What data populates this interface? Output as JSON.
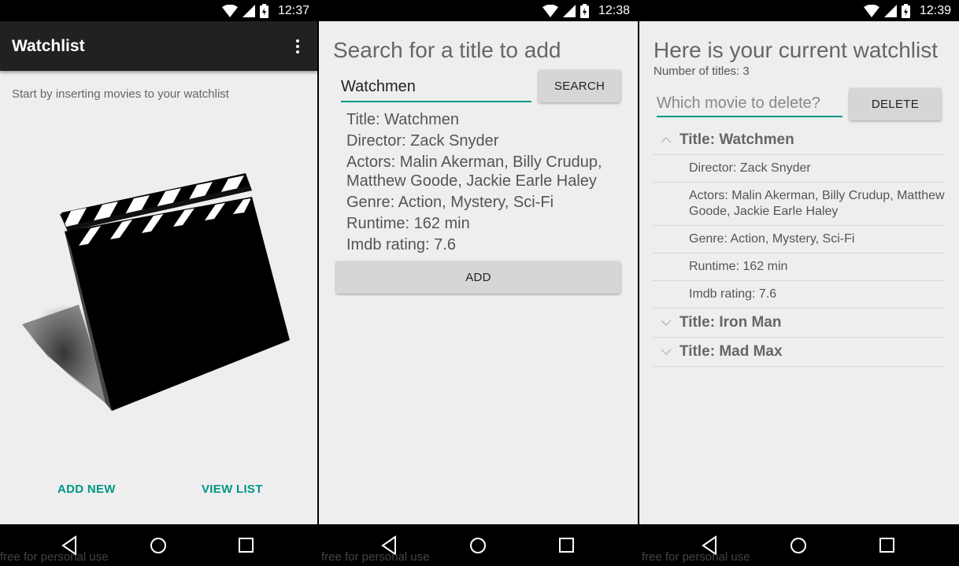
{
  "screens": [
    {
      "status_time": "12:37"
    },
    {
      "status_time": "12:38"
    },
    {
      "status_time": "12:39"
    }
  ],
  "watermark": "free for personal use",
  "main_screen": {
    "app_title": "Watchlist",
    "intro_text": "Start by inserting movies to your watchlist",
    "add_new_label": "ADD NEW",
    "view_list_label": "VIEW LIST"
  },
  "search_screen": {
    "heading": "Search for a title to add",
    "search_value": "Watchmen",
    "search_label": "SEARCH",
    "result": {
      "title": "Title: Watchmen",
      "director": "Director: Zack Snyder",
      "actors": "Actors: Malin Akerman, Billy Crudup, Matthew Goode, Jackie Earle Haley",
      "genre": "Genre: Action, Mystery, Sci-Fi",
      "runtime": "Runtime: 162 min",
      "rating": "Imdb rating: 7.6"
    },
    "add_label": "ADD"
  },
  "list_screen": {
    "heading": "Here is your current watchlist",
    "count_text": "Number of titles: 3",
    "delete_placeholder": "Which movie to delete?",
    "delete_label": "DELETE",
    "movies": [
      {
        "title": "Title: Watchmen",
        "director": "Director: Zack Snyder",
        "actors": "Actors: Malin Akerman, Billy Crudup, Matthew Goode, Jackie Earle Haley",
        "genre": "Genre: Action, Mystery, Sci-Fi",
        "runtime": "Runtime: 162 min",
        "rating": "Imdb rating: 7.6"
      },
      {
        "title": "Title: Iron Man"
      },
      {
        "title": "Title: Mad Max"
      }
    ]
  },
  "colors": {
    "accent": "#009688",
    "appbar": "#212121",
    "background": "#eeeeee"
  }
}
